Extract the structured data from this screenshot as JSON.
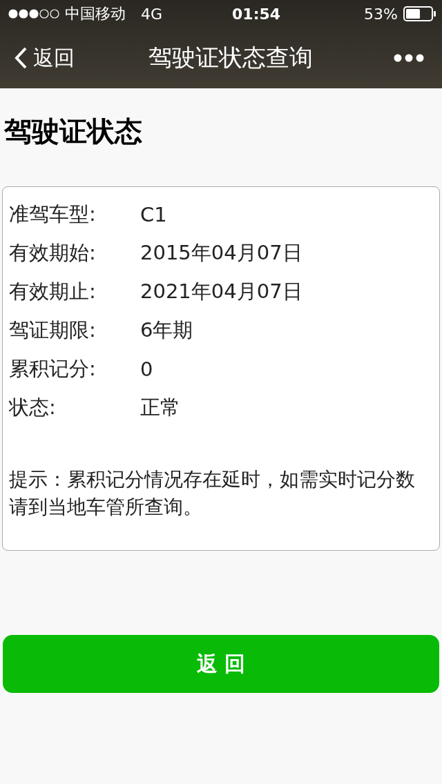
{
  "status_bar": {
    "carrier": "中国移动",
    "network": "4G",
    "time": "01:54",
    "battery": "53%"
  },
  "nav": {
    "back": "返回",
    "title": "驾驶证状态查询"
  },
  "heading": "驾驶证状态",
  "fields": [
    {
      "label": "准驾车型:",
      "value": "C1"
    },
    {
      "label": "有效期始:",
      "value": "2015年04月07日"
    },
    {
      "label": "有效期止:",
      "value": "2021年04月07日"
    },
    {
      "label": "驾证期限:",
      "value": "6年期"
    },
    {
      "label": "累积记分:",
      "value": "0"
    },
    {
      "label": "状态:",
      "value": "正常"
    }
  ],
  "tip": "提示：累积记分情况存在延时，如需实时记分数请到当地车管所查询。",
  "button": "返 回"
}
